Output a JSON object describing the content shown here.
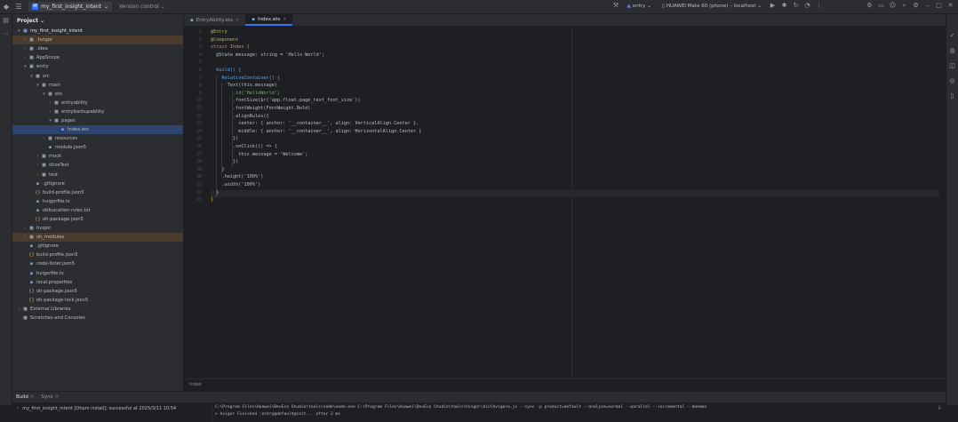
{
  "window": {
    "project_name": "my_first_insight_intent",
    "project_initials": "M",
    "vcs_label": "Version control",
    "run_config": "entry",
    "device": "HUAWEI Mate 60 (phone) – localhost"
  },
  "project_panel": {
    "title": "Project",
    "tree": [
      {
        "depth": 0,
        "arrow": "▾",
        "icon": "root",
        "label": "my_first_insight_intent",
        "hl": ""
      },
      {
        "depth": 1,
        "arrow": "›",
        "icon": "folder",
        "label": ".hvigor",
        "hl": "orange"
      },
      {
        "depth": 1,
        "arrow": "›",
        "icon": "folder",
        "label": ".idea",
        "hl": ""
      },
      {
        "depth": 1,
        "arrow": "›",
        "icon": "folder",
        "label": "AppScope",
        "hl": ""
      },
      {
        "depth": 1,
        "arrow": "▾",
        "icon": "folder",
        "label": "entry",
        "hl": ""
      },
      {
        "depth": 2,
        "arrow": "▾",
        "icon": "folder",
        "label": "src",
        "hl": ""
      },
      {
        "depth": 3,
        "arrow": "▾",
        "icon": "folder",
        "label": "main",
        "hl": ""
      },
      {
        "depth": 4,
        "arrow": "▾",
        "icon": "folder",
        "label": "ets",
        "hl": ""
      },
      {
        "depth": 5,
        "arrow": "›",
        "icon": "folder",
        "label": "entryability",
        "hl": ""
      },
      {
        "depth": 5,
        "arrow": "›",
        "icon": "folder",
        "label": "entrybackupability",
        "hl": ""
      },
      {
        "depth": 5,
        "arrow": "▾",
        "icon": "folder",
        "label": "pages",
        "hl": ""
      },
      {
        "depth": 6,
        "arrow": "",
        "icon": "file",
        "label": "Index.ets",
        "hl": "sel"
      },
      {
        "depth": 4,
        "arrow": "›",
        "icon": "folder",
        "label": "resources",
        "hl": ""
      },
      {
        "depth": 4,
        "arrow": "",
        "icon": "file",
        "label": "module.json5",
        "hl": ""
      },
      {
        "depth": 3,
        "arrow": "›",
        "icon": "folder",
        "label": "mock",
        "hl": ""
      },
      {
        "depth": 3,
        "arrow": "›",
        "icon": "folder",
        "label": "ohosTest",
        "hl": ""
      },
      {
        "depth": 3,
        "arrow": "›",
        "icon": "folder",
        "label": "test",
        "hl": ""
      },
      {
        "depth": 2,
        "arrow": "",
        "icon": "file",
        "label": ".gitignore",
        "hl": ""
      },
      {
        "depth": 2,
        "arrow": "",
        "icon": "json",
        "label": "build-profile.json5",
        "hl": ""
      },
      {
        "depth": 2,
        "arrow": "",
        "icon": "file",
        "label": "hvigorfile.ts",
        "hl": ""
      },
      {
        "depth": 2,
        "arrow": "",
        "icon": "file",
        "label": "obfuscation-rules.txt",
        "hl": ""
      },
      {
        "depth": 2,
        "arrow": "",
        "icon": "json",
        "label": "oh-package.json5",
        "hl": ""
      },
      {
        "depth": 1,
        "arrow": "›",
        "icon": "folder",
        "label": "hvigor",
        "hl": ""
      },
      {
        "depth": 1,
        "arrow": "›",
        "icon": "folder",
        "label": "oh_modules",
        "hl": "orange"
      },
      {
        "depth": 1,
        "arrow": "",
        "icon": "file",
        "label": ".gitignore",
        "hl": ""
      },
      {
        "depth": 1,
        "arrow": "",
        "icon": "json",
        "label": "build-profile.json5",
        "hl": ""
      },
      {
        "depth": 1,
        "arrow": "",
        "icon": "file",
        "label": "code-linter.json5",
        "hl": ""
      },
      {
        "depth": 1,
        "arrow": "",
        "icon": "file",
        "label": "hvigorfile.ts",
        "hl": ""
      },
      {
        "depth": 1,
        "arrow": "",
        "icon": "file",
        "label": "local.properties",
        "hl": ""
      },
      {
        "depth": 1,
        "arrow": "",
        "icon": "json",
        "label": "oh-package.json5",
        "hl": ""
      },
      {
        "depth": 1,
        "arrow": "",
        "icon": "json",
        "label": "oh-package-lock.json5",
        "hl": ""
      },
      {
        "depth": 0,
        "arrow": "›",
        "icon": "folder",
        "label": "External Libraries",
        "hl": ""
      },
      {
        "depth": 0,
        "arrow": "",
        "icon": "folder",
        "label": "Scratches and Consoles",
        "hl": ""
      }
    ]
  },
  "editor": {
    "tabs": [
      {
        "label": "EntryAbility.ets",
        "active": false
      },
      {
        "label": "Index.ets",
        "active": true
      }
    ],
    "lines": [
      {
        "n": "1",
        "text": "@Entry",
        "color": "#b3ae60"
      },
      {
        "n": "2",
        "text": "@Component",
        "color": "#b3ae60"
      },
      {
        "n": "3",
        "text": "struct Index {",
        "color": "#cf8e6d"
      },
      {
        "n": "4",
        "text": "  @State message: string = 'Hello World';",
        "color": "#bcbec4"
      },
      {
        "n": "5",
        "text": "",
        "color": "#bcbec4"
      },
      {
        "n": "6",
        "text": "  build() {",
        "color": "#56a8f5"
      },
      {
        "n": "7",
        "text": "    RelativeContainer() {",
        "color": "#56a8f5"
      },
      {
        "n": "8",
        "text": "      Text(this.message)",
        "color": "#bcbec4"
      },
      {
        "n": "9",
        "text": "        .id('HelloWorld')",
        "color": "#6aab73"
      },
      {
        "n": "10",
        "text": "        .fontSize($r('app.float.page_text_font_size'))",
        "color": "#bcbec4"
      },
      {
        "n": "11",
        "text": "        .fontWeight(FontWeight.Bold)",
        "color": "#bcbec4"
      },
      {
        "n": "12",
        "text": "        .alignRules({",
        "color": "#bcbec4"
      },
      {
        "n": "13",
        "text": "          center: { anchor: '__container__', align: VerticalAlign.Center },",
        "color": "#bcbec4"
      },
      {
        "n": "14",
        "text": "          middle: { anchor: '__container__', align: HorizontalAlign.Center }",
        "color": "#bcbec4"
      },
      {
        "n": "15",
        "text": "        })",
        "color": "#bcbec4"
      },
      {
        "n": "16",
        "text": "        .onClick(() => {",
        "color": "#bcbec4"
      },
      {
        "n": "17",
        "text": "          this.message = 'Welcome';",
        "color": "#bcbec4"
      },
      {
        "n": "18",
        "text": "        })",
        "color": "#bcbec4"
      },
      {
        "n": "19",
        "text": "    }",
        "color": "#bcbec4"
      },
      {
        "n": "20",
        "text": "    .height('100%')",
        "color": "#bcbec4"
      },
      {
        "n": "21",
        "text": "    .width('100%')",
        "color": "#bcbec4"
      },
      {
        "n": "22",
        "text": "  }",
        "color": "#bcbec4"
      },
      {
        "n": "23",
        "text": "}",
        "color": "#e0c46c"
      }
    ],
    "current_line": 22,
    "breadcrumb": "Index"
  },
  "bottom": {
    "tabs": [
      {
        "label": "Build",
        "active": true
      },
      {
        "label": "Sync",
        "active": false
      }
    ],
    "build_item": "my_first_insight_intent [Ohpm install]: successful at 2025/3/11 10:54",
    "console_lines": [
      "C:\\Program Files\\Huawei\\DevEco Studio\\tools\\node\\node.exe C:\\Program Files\\Huawei\\DevEco Studio\\tools\\hvigor\\bin\\hvigorw.js --sync -p product=default --analyze=normal --parallel --incremental --daemon",
      "> hvigor Finished :entry@default@init... after 2 ms"
    ]
  }
}
